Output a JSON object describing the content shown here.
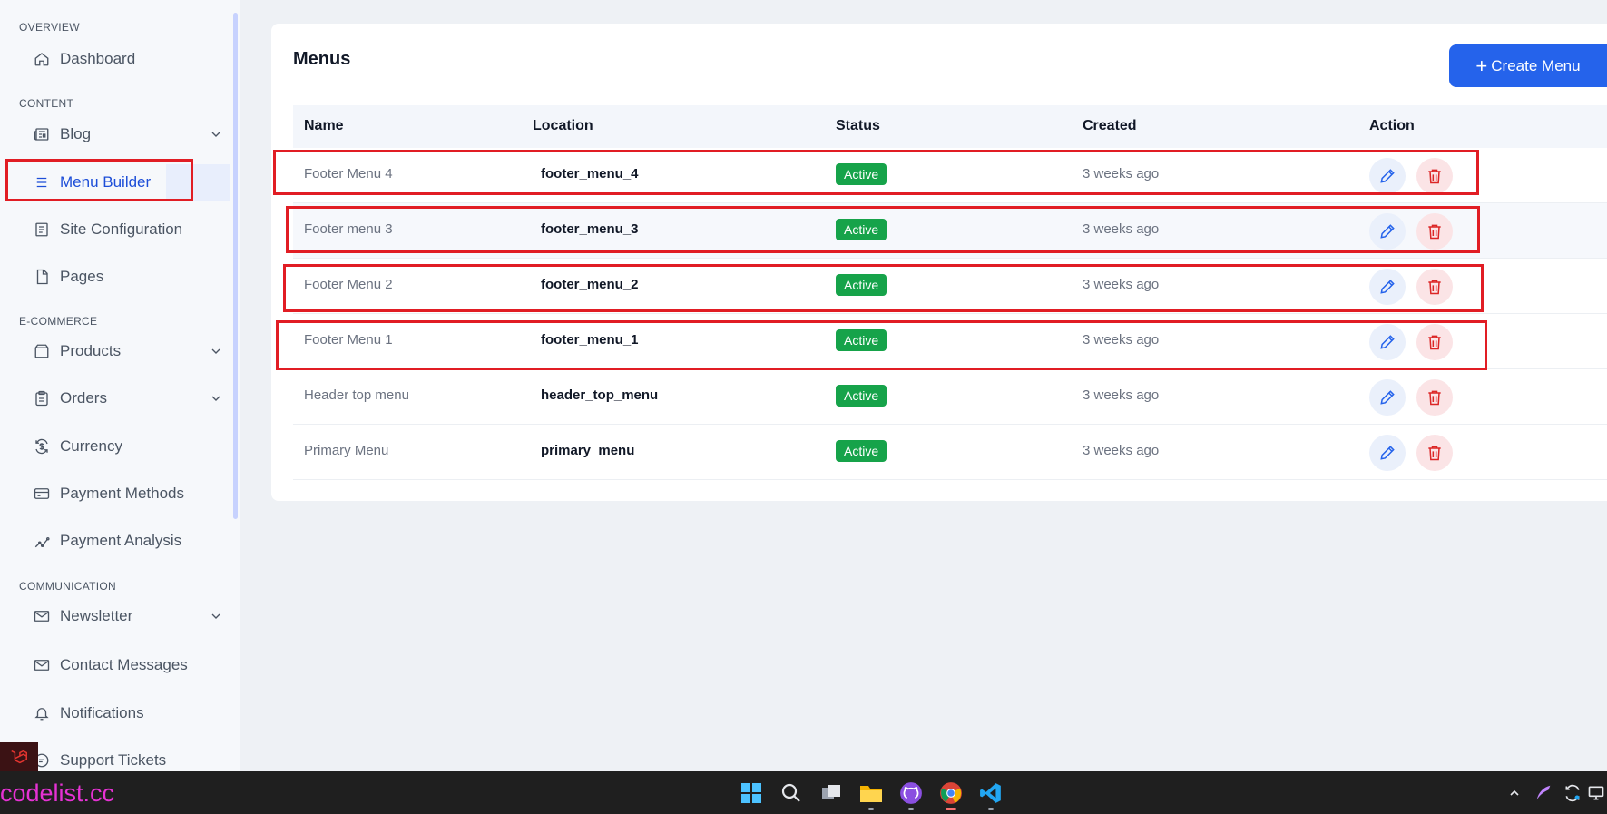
{
  "sidebar": {
    "sections": {
      "overview": "OVERVIEW",
      "content": "CONTENT",
      "ecommerce": "E-COMMERCE",
      "communication": "COMMUNICATION"
    },
    "items": {
      "dashboard": "Dashboard",
      "blog": "Blog",
      "menu_builder": "Menu Builder",
      "site_configuration": "Site Configuration",
      "pages": "Pages",
      "products": "Products",
      "orders": "Orders",
      "currency": "Currency",
      "payment_methods": "Payment Methods",
      "payment_analysis": "Payment Analysis",
      "newsletter": "Newsletter",
      "contact_messages": "Contact Messages",
      "notifications": "Notifications",
      "support_tickets": "Support Tickets"
    },
    "active_item": "Menu Builder"
  },
  "main": {
    "title": "Menus",
    "create_button": "Create Menu",
    "columns": {
      "name": "Name",
      "location": "Location",
      "status": "Status",
      "created": "Created",
      "action": "Action"
    },
    "rows": [
      {
        "name": "Footer Menu 4",
        "location": "footer_menu_4",
        "status": "Active",
        "created": "3 weeks ago"
      },
      {
        "name": "Footer menu 3",
        "location": "footer_menu_3",
        "status": "Active",
        "created": "3 weeks ago"
      },
      {
        "name": "Footer Menu 2",
        "location": "footer_menu_2",
        "status": "Active",
        "created": "3 weeks ago"
      },
      {
        "name": "Footer Menu 1",
        "location": "footer_menu_1",
        "status": "Active",
        "created": "3 weeks ago"
      },
      {
        "name": "Header top menu",
        "location": "header_top_menu",
        "status": "Active",
        "created": "3 weeks ago"
      },
      {
        "name": "Primary Menu",
        "location": "primary_menu",
        "status": "Active",
        "created": "3 weeks ago"
      }
    ]
  },
  "taskbar": {
    "brand": "codelist.cc",
    "apps": [
      "windows-start-icon",
      "search-icon",
      "task-view-icon",
      "file-explorer-icon",
      "github-desktop-icon",
      "chrome-icon",
      "vscode-icon"
    ],
    "tray": [
      "chevron-up-icon",
      "feather-icon",
      "sync-icon",
      "display-icon"
    ]
  },
  "colors": {
    "accent": "#2563eb",
    "active_badge": "#16a34a",
    "delete": "#dc2626",
    "highlight_box": "#e11d24",
    "brand_text": "#e632d4"
  }
}
